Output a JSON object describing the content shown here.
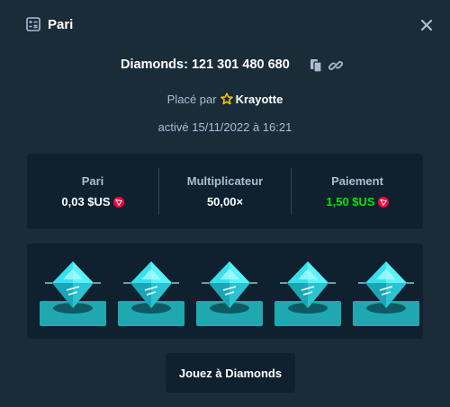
{
  "header": {
    "title": "Pari",
    "title_icon": "bet-slip-icon",
    "close_icon": "close-icon"
  },
  "bet": {
    "id_text": "Diamonds: 121 301 480 680",
    "placed_prefix": "Placé par",
    "user": "Krayotte",
    "activated": "activé 15/11/2022 à 16:21"
  },
  "stats": [
    {
      "label": "Pari",
      "value": "0,03 $US",
      "currency_icon": "tron-icon",
      "value_color": "#ffffff"
    },
    {
      "label": "Multiplicateur",
      "value": "50,00×",
      "value_color": "#ffffff"
    },
    {
      "label": "Paiement",
      "value": "1,50 $US",
      "currency_icon": "tron-icon",
      "value_color": "#00e701"
    }
  ],
  "result": {
    "tiles": [
      {
        "gem": "cyan-diamond"
      },
      {
        "gem": "cyan-diamond"
      },
      {
        "gem": "cyan-diamond"
      },
      {
        "gem": "cyan-diamond"
      },
      {
        "gem": "cyan-diamond"
      }
    ]
  },
  "cta": {
    "label": "Jouez à Diamonds"
  },
  "colors": {
    "background": "#1a2c38",
    "panel": "#0f212e",
    "text_muted": "#b1bad3",
    "text_white": "#ffffff",
    "win_green": "#00e701",
    "gem_cyan": "#36e8f2",
    "tile_teal": "#1fa8b0",
    "tron_red": "#ff003c",
    "star_yellow": "#ffce00"
  }
}
